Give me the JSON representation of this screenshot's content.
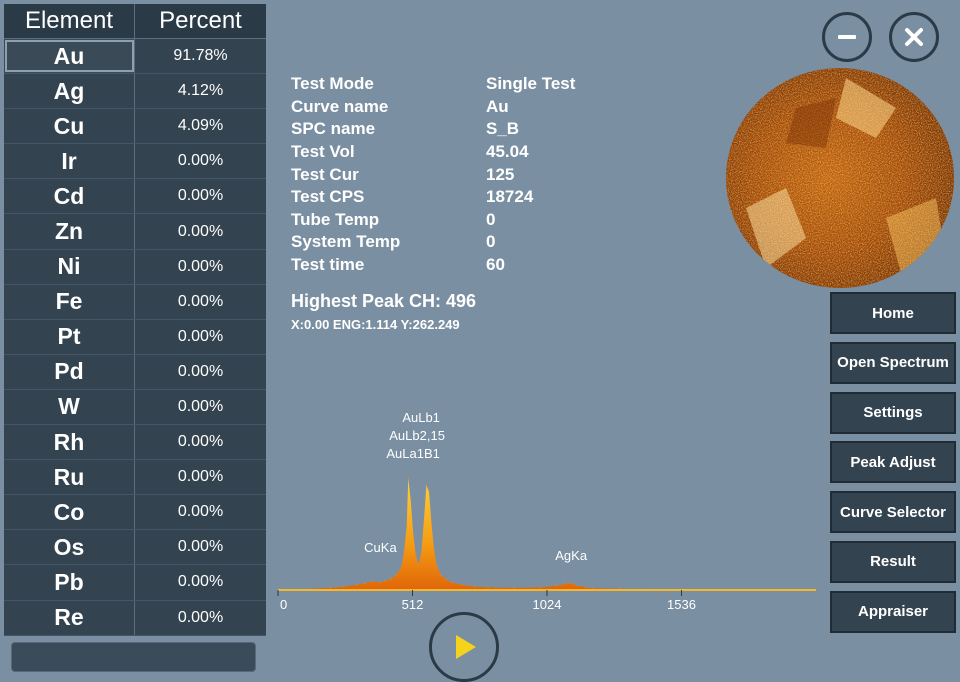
{
  "table": {
    "header_element": "Element",
    "header_percent": "Percent",
    "rows": [
      {
        "element": "Au",
        "percent": "91.78%"
      },
      {
        "element": "Ag",
        "percent": "4.12%"
      },
      {
        "element": "Cu",
        "percent": "4.09%"
      },
      {
        "element": "Ir",
        "percent": "0.00%"
      },
      {
        "element": "Cd",
        "percent": "0.00%"
      },
      {
        "element": "Zn",
        "percent": "0.00%"
      },
      {
        "element": "Ni",
        "percent": "0.00%"
      },
      {
        "element": "Fe",
        "percent": "0.00%"
      },
      {
        "element": "Pt",
        "percent": "0.00%"
      },
      {
        "element": "Pd",
        "percent": "0.00%"
      },
      {
        "element": "W",
        "percent": "0.00%"
      },
      {
        "element": "Rh",
        "percent": "0.00%"
      },
      {
        "element": "Ru",
        "percent": "0.00%"
      },
      {
        "element": "Co",
        "percent": "0.00%"
      },
      {
        "element": "Os",
        "percent": "0.00%"
      },
      {
        "element": "Pb",
        "percent": "0.00%"
      },
      {
        "element": "Re",
        "percent": "0.00%"
      }
    ]
  },
  "info": [
    {
      "label": "Test Mode",
      "value": "Single Test"
    },
    {
      "label": "Curve name",
      "value": "Au"
    },
    {
      "label": "SPC name",
      "value": "S_B"
    },
    {
      "label": "Test Vol",
      "value": "45.04"
    },
    {
      "label": "Test Cur",
      "value": "125"
    },
    {
      "label": "Test CPS",
      "value": "18724"
    },
    {
      "label": "Tube Temp",
      "value": "0"
    },
    {
      "label": "System Temp",
      "value": "0"
    },
    {
      "label": "Test time",
      "value": "60"
    }
  ],
  "peak": {
    "title": "Highest Peak CH: 496",
    "coords": "X:0.00 ENG:1.114 Y:262.249"
  },
  "menu": [
    "Home",
    "Open Spectrum",
    "Settings",
    "Peak Adjust",
    "Curve Selector",
    "Result",
    "Appraiser"
  ],
  "icons": {
    "minimize": "minus-icon",
    "close": "close-icon",
    "play": "play-icon"
  },
  "colors": {
    "background": "#7a8fa2",
    "panel": "#33434f",
    "spectrum_fill": "#f5a81c",
    "spectrum_peak": "#ff8a00",
    "play": "#f5d21c"
  },
  "chart_data": {
    "type": "area",
    "xlim": [
      0,
      2048
    ],
    "x_ticks": [
      0,
      512,
      1024,
      1536
    ],
    "annotations": [
      {
        "text": "AuLb1",
        "x": 560
      },
      {
        "text": "AuLb2,15",
        "x": 560
      },
      {
        "text": "AuLa1B1",
        "x": 560
      },
      {
        "text": "CuKa",
        "x": 390
      },
      {
        "text": "AgKa",
        "x": 1116
      }
    ],
    "series": [
      {
        "x": [
          0,
          100,
          200,
          250,
          300,
          330,
          360,
          390,
          410,
          430,
          450,
          470,
          480,
          490,
          496,
          505,
          515,
          525,
          535,
          545,
          555,
          565,
          575,
          585,
          595,
          605,
          620,
          640,
          660,
          700,
          750,
          800,
          900,
          1000,
          1060,
          1090,
          1110,
          1125,
          1140,
          1170,
          1200,
          1300,
          1400,
          1600,
          1800,
          2048
        ],
        "y": [
          0,
          2,
          5,
          8,
          12,
          16,
          20,
          18,
          22,
          26,
          35,
          55,
          90,
          150,
          262,
          210,
          130,
          80,
          60,
          85,
          160,
          245,
          230,
          150,
          90,
          55,
          35,
          25,
          18,
          12,
          8,
          6,
          5,
          6,
          10,
          14,
          16,
          14,
          10,
          6,
          4,
          3,
          2,
          1,
          1,
          0
        ]
      }
    ]
  }
}
